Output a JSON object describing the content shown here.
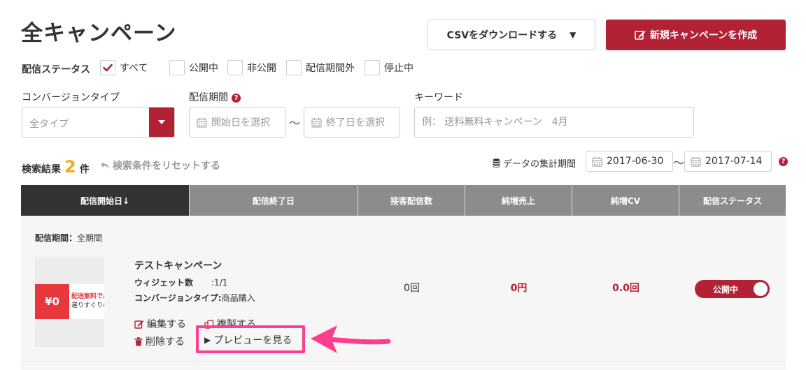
{
  "header": {
    "title": "全キャンペーン",
    "csv_label": "CSVをダウンロードする",
    "csv_caret": "▼",
    "create_label": "新規キャンペーンを作成"
  },
  "status_filter": {
    "label": "配信ステータス",
    "options": [
      {
        "label": "すべて",
        "checked": true
      },
      {
        "label": "公開中",
        "checked": false
      },
      {
        "label": "非公開",
        "checked": false
      },
      {
        "label": "配信期間外",
        "checked": false
      },
      {
        "label": "停止中",
        "checked": false
      }
    ]
  },
  "filters": {
    "conversion_label": "コンバージョンタイプ",
    "conversion_value": "全タイプ",
    "period_label": "配信期間",
    "help_glyph": "?",
    "start_placeholder": "開始日を選択",
    "end_placeholder": "終了日を選択",
    "tilde": "〜",
    "keyword_label": "キーワード",
    "keyword_placeholder": "例： 送料無料キャンペーン　4月"
  },
  "results": {
    "label": "検索結果",
    "count": "2",
    "unit": "件",
    "reset_label": "検索条件をリセットする",
    "aggregation_label": "データの集計期間",
    "period_start": "2017-06-30",
    "period_end": "2017-07-14",
    "tilde": "〜"
  },
  "table": {
    "headers": [
      "配信開始日↓",
      "配信終了日",
      "接客配信数",
      "純増売上",
      "純増CV",
      "配信ステータス"
    ],
    "row": {
      "period_key": "配信期間：",
      "period_value": "全期間",
      "thumb_badge": "¥0",
      "thumb_line1": "配送無料でお…",
      "thumb_line2": "選りすぐりの…",
      "name": "テストキャンペーン",
      "widget_key": "ウィジェット数",
      "widget_value": ":1/1",
      "conversion_key": "コンバージョンタイプ:",
      "conversion_value": "商品購入",
      "deliveries": "0回",
      "sales": "0円",
      "cv": "0.0回",
      "status": "公開中",
      "actions": {
        "edit": "編集する",
        "copy": "複製する",
        "delete": "削除する",
        "preview": "プレビューを見る",
        "preview_glyph": "▶"
      }
    }
  },
  "colors": {
    "brand": "#b22234",
    "highlight": "#ff3e8e",
    "count": "#f5a623"
  }
}
